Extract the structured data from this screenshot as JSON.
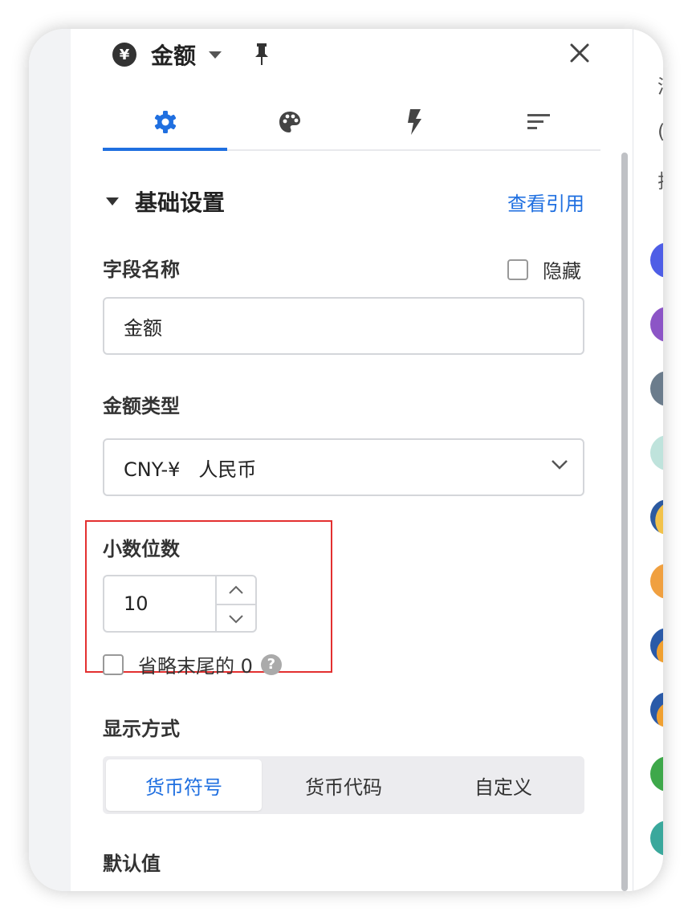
{
  "header": {
    "currency_symbol": "¥",
    "title": "金额"
  },
  "tabs": [
    {
      "icon": "gear-icon",
      "active": true
    },
    {
      "icon": "palette-icon",
      "active": false
    },
    {
      "icon": "lightning-icon",
      "active": false
    },
    {
      "icon": "sort-lines-icon",
      "active": false
    }
  ],
  "section": {
    "title": "基础设置",
    "link": "查看引用"
  },
  "field_name": {
    "label": "字段名称",
    "hide_label": "隐藏",
    "value": "金额"
  },
  "amount_type": {
    "label": "金额类型",
    "selected": "CNY-¥   人民币"
  },
  "decimal": {
    "label": "小数位数",
    "value": "10",
    "omit_label": "省略末尾的 0",
    "help": "?"
  },
  "display_mode": {
    "label": "显示方式",
    "options": [
      "货币符号",
      "货币代码",
      "自定义"
    ],
    "selected_index": 0
  },
  "default_value": {
    "label": "默认值"
  },
  "right_panel": {
    "fragments": [
      "清",
      "(",
      "排"
    ]
  },
  "colors": {
    "accent": "#1f6fe0",
    "highlight_border": "#e33030"
  }
}
